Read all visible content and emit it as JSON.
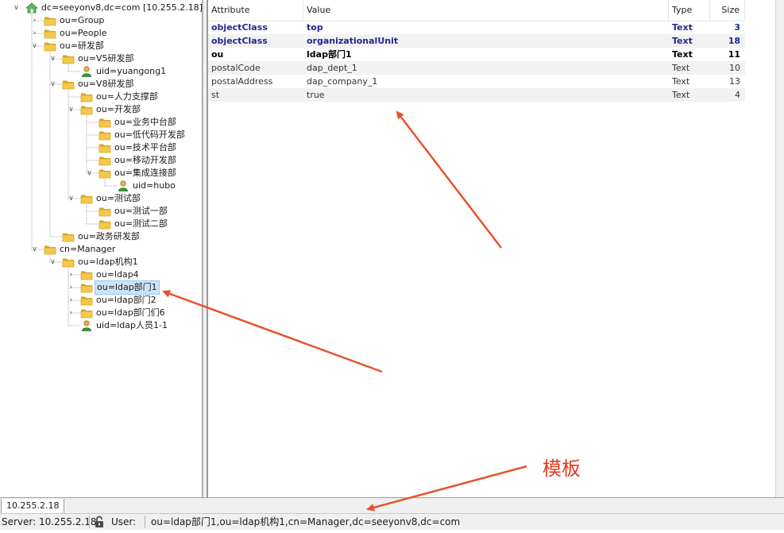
{
  "tree": {
    "items": [
      {
        "label": "dc=seeyonv8,dc=com [10.255.2.18]",
        "icon": "server-icon",
        "expander": "open",
        "level": 0
      },
      {
        "label": "ou=Group",
        "icon": "folder-icon",
        "expander": "closed",
        "level": 1
      },
      {
        "label": "ou=People",
        "icon": "folder-icon",
        "expander": "closed",
        "level": 1
      },
      {
        "label": "ou=研发部",
        "icon": "folder-icon",
        "expander": "open",
        "level": 1
      },
      {
        "label": "ou=V5研发部",
        "icon": "folder-icon",
        "expander": "open",
        "level": 2
      },
      {
        "label": "uid=yuangong1",
        "icon": "user-icon",
        "expander": "none",
        "level": 3
      },
      {
        "label": "ou=V8研发部",
        "icon": "folder-icon",
        "expander": "open",
        "level": 2
      },
      {
        "label": "ou=人力支撑部",
        "icon": "folder-icon",
        "expander": "none",
        "level": 3
      },
      {
        "label": "ou=开发部",
        "icon": "folder-icon",
        "expander": "open",
        "level": 3
      },
      {
        "label": "ou=业务中台部",
        "icon": "folder-icon",
        "expander": "none",
        "level": 4
      },
      {
        "label": "ou=低代码开发部",
        "icon": "folder-icon",
        "expander": "none",
        "level": 4
      },
      {
        "label": "ou=技术平台部",
        "icon": "folder-icon",
        "expander": "none",
        "level": 4
      },
      {
        "label": "ou=移动开发部",
        "icon": "folder-icon",
        "expander": "none",
        "level": 4
      },
      {
        "label": "ou=集成连接部",
        "icon": "folder-icon",
        "expander": "open",
        "level": 4
      },
      {
        "label": "uid=hubo",
        "icon": "user-icon",
        "expander": "none",
        "level": 5
      },
      {
        "label": "ou=测试部",
        "icon": "folder-icon",
        "expander": "open",
        "level": 3
      },
      {
        "label": "ou=测试一部",
        "icon": "folder-icon",
        "expander": "none",
        "level": 4
      },
      {
        "label": "ou=测试二部",
        "icon": "folder-icon",
        "expander": "none",
        "level": 4
      },
      {
        "label": "ou=政务研发部",
        "icon": "folder-icon",
        "expander": "none",
        "level": 2
      },
      {
        "label": "cn=Manager",
        "icon": "folder-icon",
        "expander": "open",
        "level": 1
      },
      {
        "label": "ou=ldap机构1",
        "icon": "folder-icon",
        "expander": "open",
        "level": 2
      },
      {
        "label": "ou=ldap4",
        "icon": "folder-icon",
        "expander": "closed",
        "level": 3
      },
      {
        "label": "ou=ldap部门1",
        "icon": "folder-icon",
        "expander": "closed",
        "level": 3,
        "selected": true
      },
      {
        "label": "ou=ldap部门2",
        "icon": "folder-icon",
        "expander": "closed",
        "level": 3
      },
      {
        "label": "ou=ldap部门们6",
        "icon": "folder-icon",
        "expander": "closed",
        "level": 3
      },
      {
        "label": "uid=ldap人员1-1",
        "icon": "user-icon",
        "expander": "none",
        "level": 3
      }
    ]
  },
  "attributes": {
    "columns": {
      "attribute": "Attribute",
      "value": "Value",
      "type": "Type",
      "size": "Size"
    },
    "rows": [
      {
        "attribute": "objectClass",
        "value": "top",
        "type": "Text",
        "size": "3",
        "style": "blue"
      },
      {
        "attribute": "objectClass",
        "value": "organizationalUnit",
        "type": "Text",
        "size": "18",
        "style": "blue"
      },
      {
        "attribute": "ou",
        "value": "ldap部门1",
        "type": "Text",
        "size": "11",
        "style": "bold"
      },
      {
        "attribute": "postalCode",
        "value": "dap_dept_1",
        "type": "Text",
        "size": "10",
        "style": "plain"
      },
      {
        "attribute": "postalAddress",
        "value": "dap_company_1",
        "type": "Text",
        "size": "13",
        "style": "plain"
      },
      {
        "attribute": "st",
        "value": "true",
        "type": "Text",
        "size": "4",
        "style": "plain"
      }
    ]
  },
  "tabs": {
    "server_tab": "10.255.2.18"
  },
  "status": {
    "server": "Server: 10.255.2.18",
    "user_label": "User:",
    "dn": "ou=ldap部门1,ou=ldap机构1,cn=Manager,dc=seeyonv8,dc=com"
  },
  "annotation": {
    "text": "模板",
    "color": "#e23b1c"
  },
  "colors": {
    "folder": "#f2c94c",
    "folder_dark": "#d9a520",
    "selection": "#cce4f7",
    "bold_blue": "#1f2a8f",
    "arrow": "#e8532b"
  }
}
